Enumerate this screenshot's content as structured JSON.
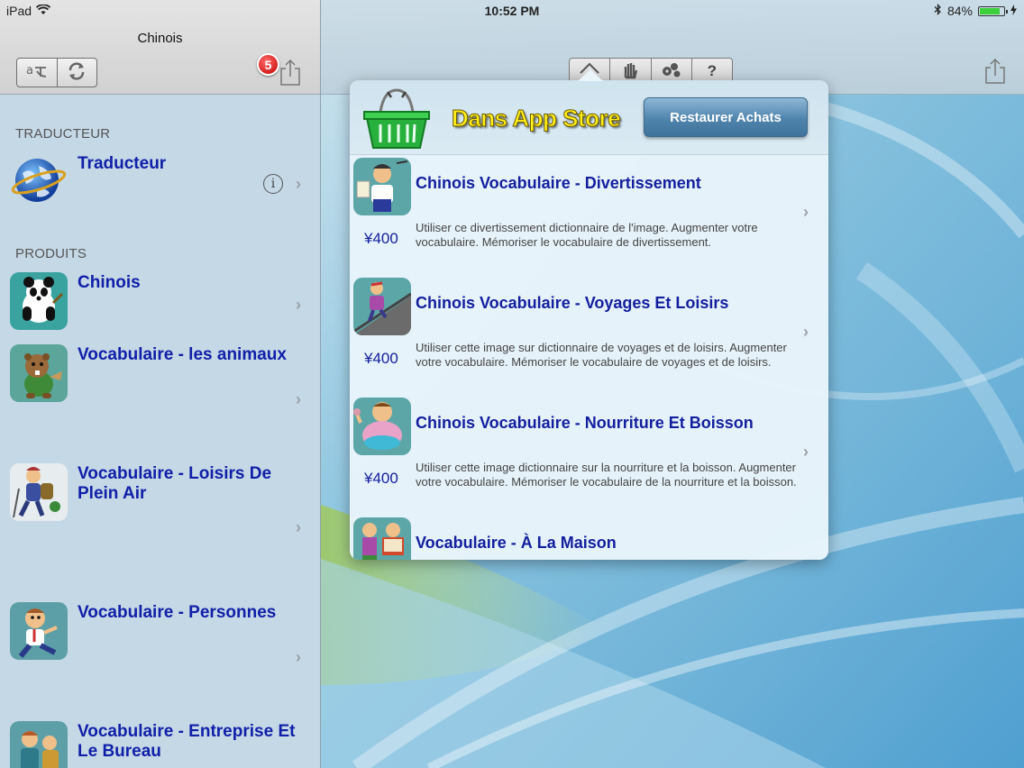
{
  "status_bar": {
    "device": "iPad",
    "time": "10:52 PM",
    "battery_percent": "84%",
    "battery_level": 0.84
  },
  "sidebar": {
    "title": "Chinois",
    "badge_count": "5",
    "sections": [
      {
        "header": "TRADUCTEUR",
        "items": [
          {
            "title": "Traducteur",
            "thumb": "globe-thumb"
          }
        ]
      },
      {
        "header": "PRODUITS",
        "items": [
          {
            "title": "Chinois",
            "thumb": "panda-thumb"
          },
          {
            "title": "Vocabulaire - les animaux",
            "thumb": "beaver-thumb"
          },
          {
            "title": "Vocabulaire - Loisirs De Plein Air",
            "thumb": "hiker-thumb"
          },
          {
            "title": "Vocabulaire - Personnes",
            "thumb": "person-thumb"
          },
          {
            "title": "Vocabulaire - Entreprise Et Le Bureau",
            "thumb": "office-thumb"
          }
        ]
      }
    ]
  },
  "toolbar": {
    "icons": [
      "home-icon",
      "hand-icon",
      "gear-cluster-icon",
      "help-icon"
    ],
    "help_label": "?"
  },
  "store": {
    "title": "Dans App Store",
    "restore_label": "Restaurer Achats",
    "products": [
      {
        "title": "Chinois Vocabulaire - Divertissement",
        "price": "¥400",
        "description": "Utiliser ce divertissement dictionnaire de l'image.  Augmenter votre vocabulaire.  Mémoriser le vocabulaire de divertissement.",
        "thumb": "entertainer-thumb"
      },
      {
        "title": "Chinois Vocabulaire - Voyages Et Loisirs",
        "price": "¥400",
        "description": "Utiliser cette image sur dictionnaire de voyages et de loisirs.  Augmenter votre vocabulaire.  Mémoriser le vocabulaire de voyages et de loisirs.",
        "thumb": "traveler-thumb"
      },
      {
        "title": "Chinois Vocabulaire - Nourriture Et Boisson",
        "price": "¥400",
        "description": "Utiliser cette image dictionnaire sur la nourriture et la boisson.  Augmenter votre vocabulaire.  Mémoriser le vocabulaire de la nourriture et la boisson.",
        "thumb": "eater-thumb"
      },
      {
        "title": "Vocabulaire - À La Maison",
        "price": "",
        "description": "",
        "thumb": "home-reader-thumb"
      }
    ]
  },
  "colors": {
    "link_blue": "#1020a8",
    "store_title_yellow": "#ffef1a",
    "restore_button": "#4f84ad",
    "badge_red": "#d40000"
  }
}
